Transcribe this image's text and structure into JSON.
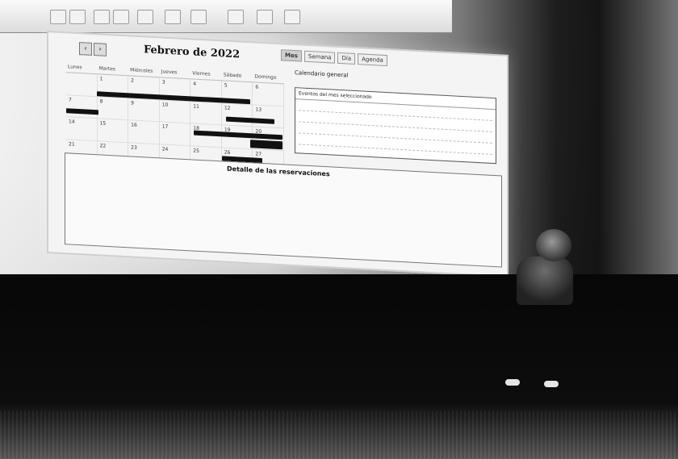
{
  "calendar": {
    "month_title": "Febrero de 2022",
    "view_buttons": [
      "Mes",
      "Semana",
      "Día",
      "Agenda"
    ],
    "weekdays": [
      "Lunes",
      "Martes",
      "Miércoles",
      "Jueves",
      "Viernes",
      "Sábado",
      "Domingo"
    ],
    "weeks": [
      [
        "",
        "1",
        "2",
        "3",
        "4",
        "5",
        "6"
      ],
      [
        "7",
        "8",
        "9",
        "10",
        "11",
        "12",
        "13"
      ],
      [
        "14",
        "15",
        "16",
        "17",
        "18",
        "19",
        "20"
      ],
      [
        "21",
        "22",
        "23",
        "24",
        "25",
        "26",
        "27"
      ]
    ]
  },
  "side_panel": {
    "title": "Calendario general",
    "box_heading": "Eventos del mes seleccionado"
  },
  "details": {
    "title": "Detalle de las reservaciones"
  }
}
